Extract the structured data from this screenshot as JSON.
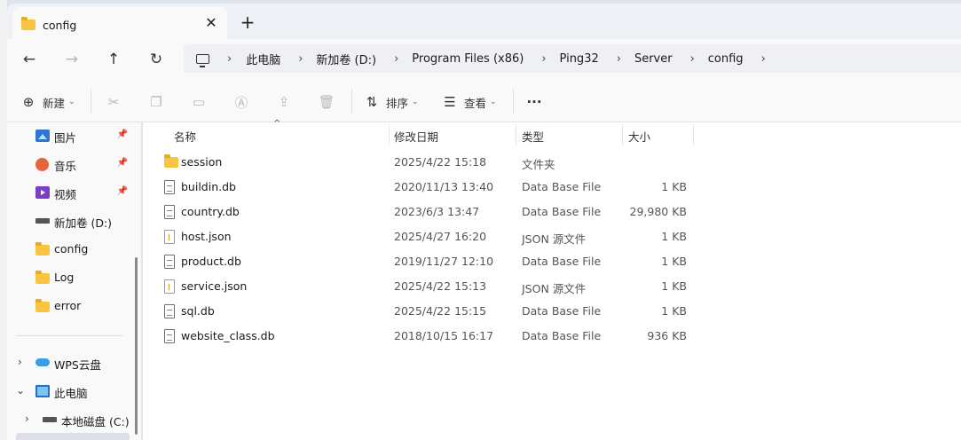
{
  "tab": {
    "title": "config",
    "close_glyph": "✕",
    "new_tab_glyph": "+"
  },
  "nav": {
    "back": "←",
    "forward": "→",
    "up": "↑",
    "refresh": "↻"
  },
  "breadcrumb": [
    "此电脑",
    "新加卷 (D:)",
    "Program Files (x86)",
    "Ping32",
    "Server",
    "config"
  ],
  "breadcrumb_separator": "›",
  "toolbar": {
    "new_label": "新建",
    "sort_label": "排序",
    "view_label": "查看",
    "more_glyph": "···"
  },
  "sidebar": {
    "pinned": [
      {
        "label": "图片",
        "icon": "pictures-icon"
      },
      {
        "label": "音乐",
        "icon": "music-icon"
      },
      {
        "label": "视频",
        "icon": "videos-icon"
      }
    ],
    "recent": [
      {
        "label": "新加卷 (D:)",
        "icon": "drive-icon"
      },
      {
        "label": "config",
        "icon": "folder-icon"
      },
      {
        "label": "Log",
        "icon": "folder-icon"
      },
      {
        "label": "error",
        "icon": "folder-icon"
      }
    ],
    "tree": [
      {
        "label": "WPS云盘",
        "icon": "cloud-icon",
        "expanded": false
      },
      {
        "label": "此电脑",
        "icon": "this-pc-icon",
        "expanded": true
      },
      {
        "label": "本地磁盘 (C:)",
        "icon": "drive-icon",
        "expanded": false
      }
    ],
    "pin_glyph": "📌"
  },
  "columns": {
    "name": "名称",
    "modified": "修改日期",
    "type": "类型",
    "size": "大小"
  },
  "files": [
    {
      "name": "session",
      "modified": "2025/4/22 15:18",
      "type": "文件夹",
      "size": "",
      "icon": "folder"
    },
    {
      "name": "buildin.db",
      "modified": "2020/11/13 13:40",
      "type": "Data Base File",
      "size": "1 KB",
      "icon": "db"
    },
    {
      "name": "country.db",
      "modified": "2023/6/3 13:47",
      "type": "Data Base File",
      "size": "29,980 KB",
      "icon": "db"
    },
    {
      "name": "host.json",
      "modified": "2025/4/27 16:20",
      "type": "JSON 源文件",
      "size": "1 KB",
      "icon": "json"
    },
    {
      "name": "product.db",
      "modified": "2019/11/27 12:10",
      "type": "Data Base File",
      "size": "1 KB",
      "icon": "db"
    },
    {
      "name": "service.json",
      "modified": "2025/4/22 15:13",
      "type": "JSON 源文件",
      "size": "1 KB",
      "icon": "json"
    },
    {
      "name": "sql.db",
      "modified": "2025/4/22 15:15",
      "type": "Data Base File",
      "size": "1 KB",
      "icon": "db"
    },
    {
      "name": "website_class.db",
      "modified": "2018/10/15 16:17",
      "type": "Data Base File",
      "size": "936 KB",
      "icon": "db"
    }
  ]
}
